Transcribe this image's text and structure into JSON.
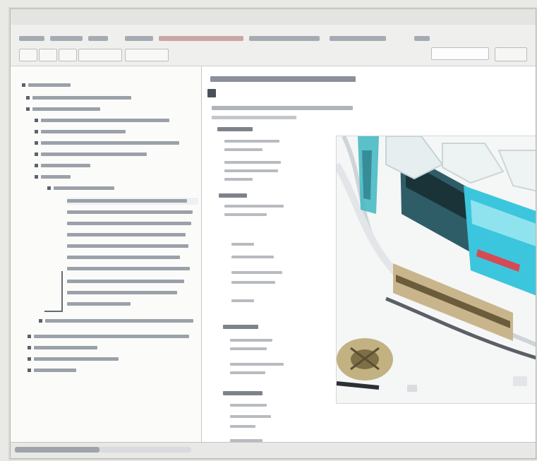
{
  "window": {
    "title": ""
  },
  "toolbar": {
    "search_placeholder": ""
  },
  "content": {
    "print_label": ""
  },
  "colors": {
    "figure_teal": "#3dbcc9",
    "figure_tan": "#c6b48a",
    "figure_dark": "#4e5359",
    "window_bg": "#f4f4f2"
  },
  "icons": {
    "print": "printer-icon",
    "toc_folder": "book-icon",
    "search": "search-icon"
  },
  "status": {
    "text": ""
  }
}
